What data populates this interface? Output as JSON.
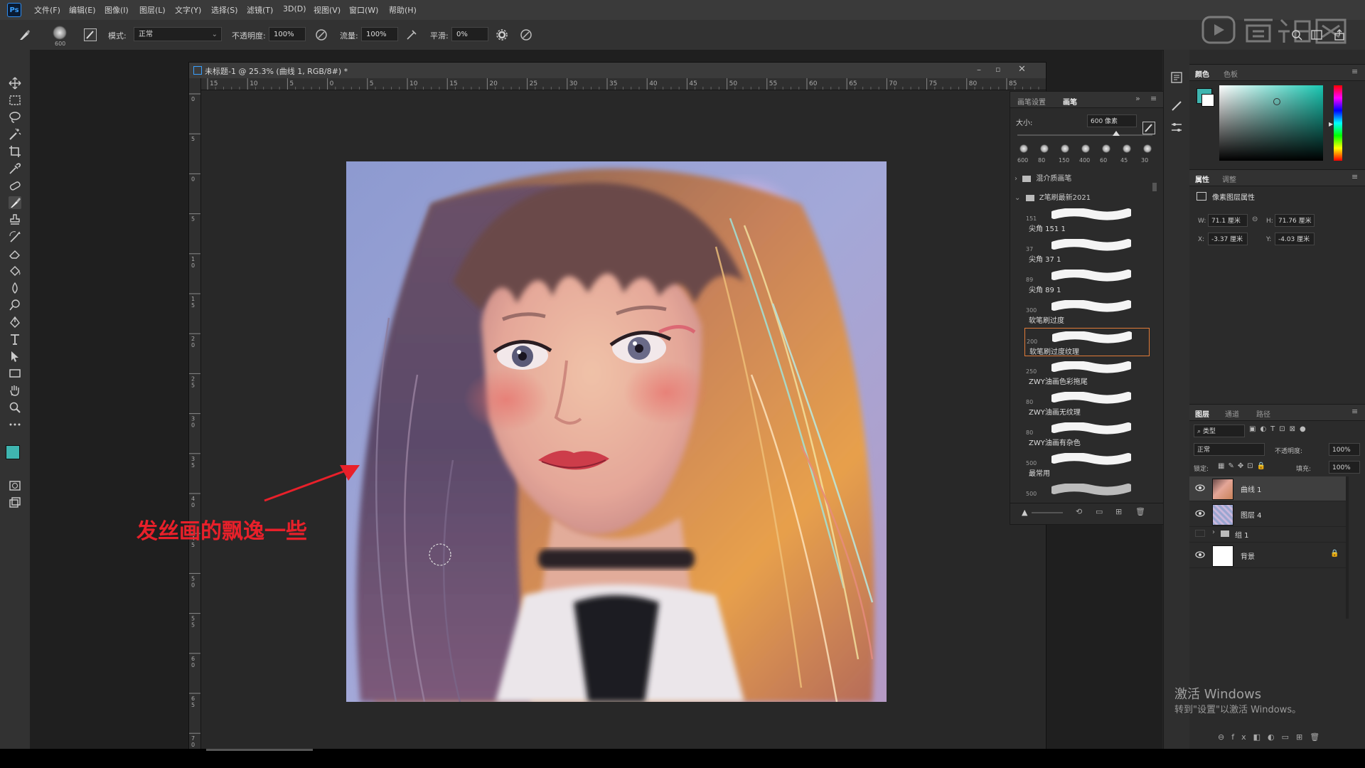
{
  "app": {
    "logo_text": "Ps",
    "menu": [
      "文件(F)",
      "编辑(E)",
      "图像(I)",
      "图层(L)",
      "文字(Y)",
      "选择(S)",
      "滤镜(T)",
      "3D(D)",
      "视图(V)",
      "窗口(W)",
      "帮助(H)"
    ]
  },
  "options_bar": {
    "brush_size": "600",
    "mode_label": "模式:",
    "mode_value": "正常",
    "opacity_label": "不透明度:",
    "opacity_value": "100%",
    "flow_label": "流量:",
    "flow_value": "100%",
    "smoothing_label": "平滑:",
    "smoothing_value": "0%"
  },
  "document": {
    "title": "未标题-1 @ 25.3% (曲线 1, RGB/8#) *",
    "ruler_h": [
      "15",
      "10",
      "5",
      "0",
      "5",
      "10",
      "15",
      "20",
      "25",
      "30",
      "35",
      "40",
      "45",
      "50",
      "55",
      "60",
      "65",
      "70",
      "75",
      "80",
      "85"
    ],
    "ruler_v": [
      "0",
      "5",
      "0",
      "5",
      "1 0",
      "1 5",
      "2 0",
      "2 5",
      "3 0",
      "3 5",
      "4 0",
      "4 5",
      "5 0",
      "5 5",
      "6 0",
      "6 5",
      "7 0"
    ]
  },
  "annotation": {
    "text": "发丝画的飘逸一些",
    "color": "#e8202a"
  },
  "brush_panel": {
    "tab_settings": "画笔设置",
    "tab_brushes": "画笔",
    "size_label": "大小:",
    "size_value": "600 像素",
    "presets": [
      "600",
      "80",
      "150",
      "400",
      "60",
      "45",
      "30"
    ],
    "groups": [
      {
        "name": "混介质画笔",
        "expanded": false
      },
      {
        "name": "Z笔刷最新2021",
        "expanded": true
      }
    ],
    "brushes": [
      {
        "size": "151",
        "name": "尖角 151 1"
      },
      {
        "size": "37",
        "name": "尖角 37 1"
      },
      {
        "size": "89",
        "name": "尖角 89 1"
      },
      {
        "size": "300",
        "name": "软笔刷过度"
      },
      {
        "size": "200",
        "name": "软笔刷过度纹理"
      },
      {
        "size": "250",
        "name": "ZWY油画色彩拖尾"
      },
      {
        "size": "80",
        "name": "ZWY油画无纹理"
      },
      {
        "size": "80",
        "name": "ZWY油画有杂色"
      },
      {
        "size": "500",
        "name": "最常用"
      },
      {
        "size": "500",
        "name": ""
      }
    ],
    "selected_index": 4
  },
  "color_panel": {
    "tab_color": "颜色",
    "tab_swatches": "色板",
    "foreground": "#3fb5b0",
    "background": "#ffffff",
    "accent": "#e07b39"
  },
  "properties_panel": {
    "tab_properties": "属性",
    "tab_adjustments": "调整",
    "section": "像素图层属性",
    "w_label": "W:",
    "w_value": "71.1 厘米",
    "h_label": "H:",
    "h_value": "71.76 厘米",
    "x_label": "X:",
    "x_value": "-3.37 厘米",
    "y_label": "Y:",
    "y_value": "-4.03 厘米"
  },
  "layers_panel": {
    "tab_layers": "图层",
    "tab_channels": "通道",
    "tab_paths": "路径",
    "filter": "类型",
    "blend_mode": "正常",
    "opacity_label": "不透明度:",
    "opacity_value": "100%",
    "lock_label": "锁定:",
    "fill_label": "填充:",
    "fill_value": "100%",
    "layers": [
      {
        "name": "曲线 1",
        "visible": true,
        "selected": true
      },
      {
        "name": "图层 4",
        "visible": true,
        "selected": false
      },
      {
        "name": "组 1",
        "visible": false,
        "selected": false
      },
      {
        "name": "背景",
        "visible": true,
        "selected": false
      }
    ]
  },
  "watermark": {
    "line1": "激活 Windows",
    "line2": "转到\"设置\"以激活 Windows。"
  }
}
